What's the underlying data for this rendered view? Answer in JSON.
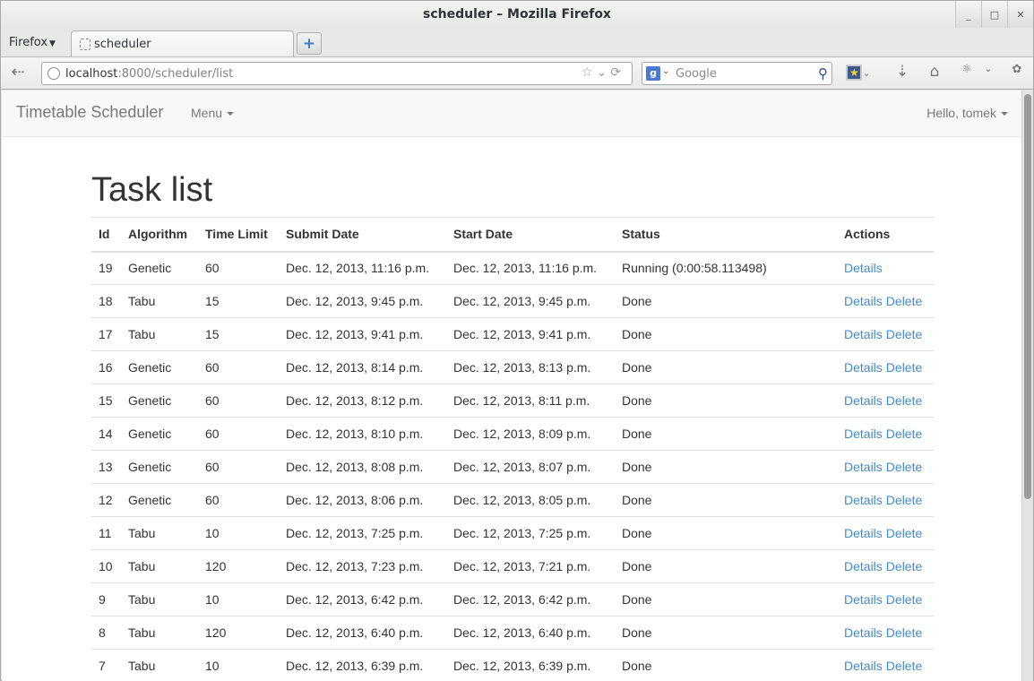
{
  "window": {
    "title": "scheduler – Mozilla Firefox"
  },
  "browser": {
    "menu_label": "Firefox",
    "tab_title": "scheduler",
    "url_host": "localhost",
    "url_rest": ":8000/scheduler/list",
    "search_placeholder": "Google",
    "search_engine_glyph": "g"
  },
  "app": {
    "brand": "Timetable Scheduler",
    "menu_label": "Menu",
    "user_greeting": "Hello, tomek"
  },
  "page": {
    "title": "Task list"
  },
  "table": {
    "headers": [
      "Id",
      "Algorithm",
      "Time Limit",
      "Submit Date",
      "Start Date",
      "Status",
      "Actions"
    ],
    "rows": [
      {
        "id": "19",
        "algorithm": "Genetic",
        "time_limit": "60",
        "submit": "Dec. 12, 2013, 11:16 p.m.",
        "start": "Dec. 12, 2013, 11:16 p.m.",
        "status": "Running (0:00:58.113498)",
        "actions": [
          "Details"
        ]
      },
      {
        "id": "18",
        "algorithm": "Tabu",
        "time_limit": "15",
        "submit": "Dec. 12, 2013, 9:45 p.m.",
        "start": "Dec. 12, 2013, 9:45 p.m.",
        "status": "Done",
        "actions": [
          "Details",
          "Delete"
        ]
      },
      {
        "id": "17",
        "algorithm": "Tabu",
        "time_limit": "15",
        "submit": "Dec. 12, 2013, 9:41 p.m.",
        "start": "Dec. 12, 2013, 9:41 p.m.",
        "status": "Done",
        "actions": [
          "Details",
          "Delete"
        ]
      },
      {
        "id": "16",
        "algorithm": "Genetic",
        "time_limit": "60",
        "submit": "Dec. 12, 2013, 8:14 p.m.",
        "start": "Dec. 12, 2013, 8:13 p.m.",
        "status": "Done",
        "actions": [
          "Details",
          "Delete"
        ]
      },
      {
        "id": "15",
        "algorithm": "Genetic",
        "time_limit": "60",
        "submit": "Dec. 12, 2013, 8:12 p.m.",
        "start": "Dec. 12, 2013, 8:11 p.m.",
        "status": "Done",
        "actions": [
          "Details",
          "Delete"
        ]
      },
      {
        "id": "14",
        "algorithm": "Genetic",
        "time_limit": "60",
        "submit": "Dec. 12, 2013, 8:10 p.m.",
        "start": "Dec. 12, 2013, 8:09 p.m.",
        "status": "Done",
        "actions": [
          "Details",
          "Delete"
        ]
      },
      {
        "id": "13",
        "algorithm": "Genetic",
        "time_limit": "60",
        "submit": "Dec. 12, 2013, 8:08 p.m.",
        "start": "Dec. 12, 2013, 8:07 p.m.",
        "status": "Done",
        "actions": [
          "Details",
          "Delete"
        ]
      },
      {
        "id": "12",
        "algorithm": "Genetic",
        "time_limit": "60",
        "submit": "Dec. 12, 2013, 8:06 p.m.",
        "start": "Dec. 12, 2013, 8:05 p.m.",
        "status": "Done",
        "actions": [
          "Details",
          "Delete"
        ]
      },
      {
        "id": "11",
        "algorithm": "Tabu",
        "time_limit": "10",
        "submit": "Dec. 12, 2013, 7:25 p.m.",
        "start": "Dec. 12, 2013, 7:25 p.m.",
        "status": "Done",
        "actions": [
          "Details",
          "Delete"
        ]
      },
      {
        "id": "10",
        "algorithm": "Tabu",
        "time_limit": "120",
        "submit": "Dec. 12, 2013, 7:23 p.m.",
        "start": "Dec. 12, 2013, 7:21 p.m.",
        "status": "Done",
        "actions": [
          "Details",
          "Delete"
        ]
      },
      {
        "id": "9",
        "algorithm": "Tabu",
        "time_limit": "10",
        "submit": "Dec. 12, 2013, 6:42 p.m.",
        "start": "Dec. 12, 2013, 6:42 p.m.",
        "status": "Done",
        "actions": [
          "Details",
          "Delete"
        ]
      },
      {
        "id": "8",
        "algorithm": "Tabu",
        "time_limit": "120",
        "submit": "Dec. 12, 2013, 6:40 p.m.",
        "start": "Dec. 12, 2013, 6:40 p.m.",
        "status": "Done",
        "actions": [
          "Details",
          "Delete"
        ]
      },
      {
        "id": "7",
        "algorithm": "Tabu",
        "time_limit": "10",
        "submit": "Dec. 12, 2013, 6:39 p.m.",
        "start": "Dec. 12, 2013, 6:39 p.m.",
        "status": "Done",
        "actions": [
          "Details",
          "Delete"
        ]
      }
    ]
  },
  "colors": {
    "link": "#428bca",
    "text": "#333333",
    "navbar_bg": "#f8f8f8"
  }
}
